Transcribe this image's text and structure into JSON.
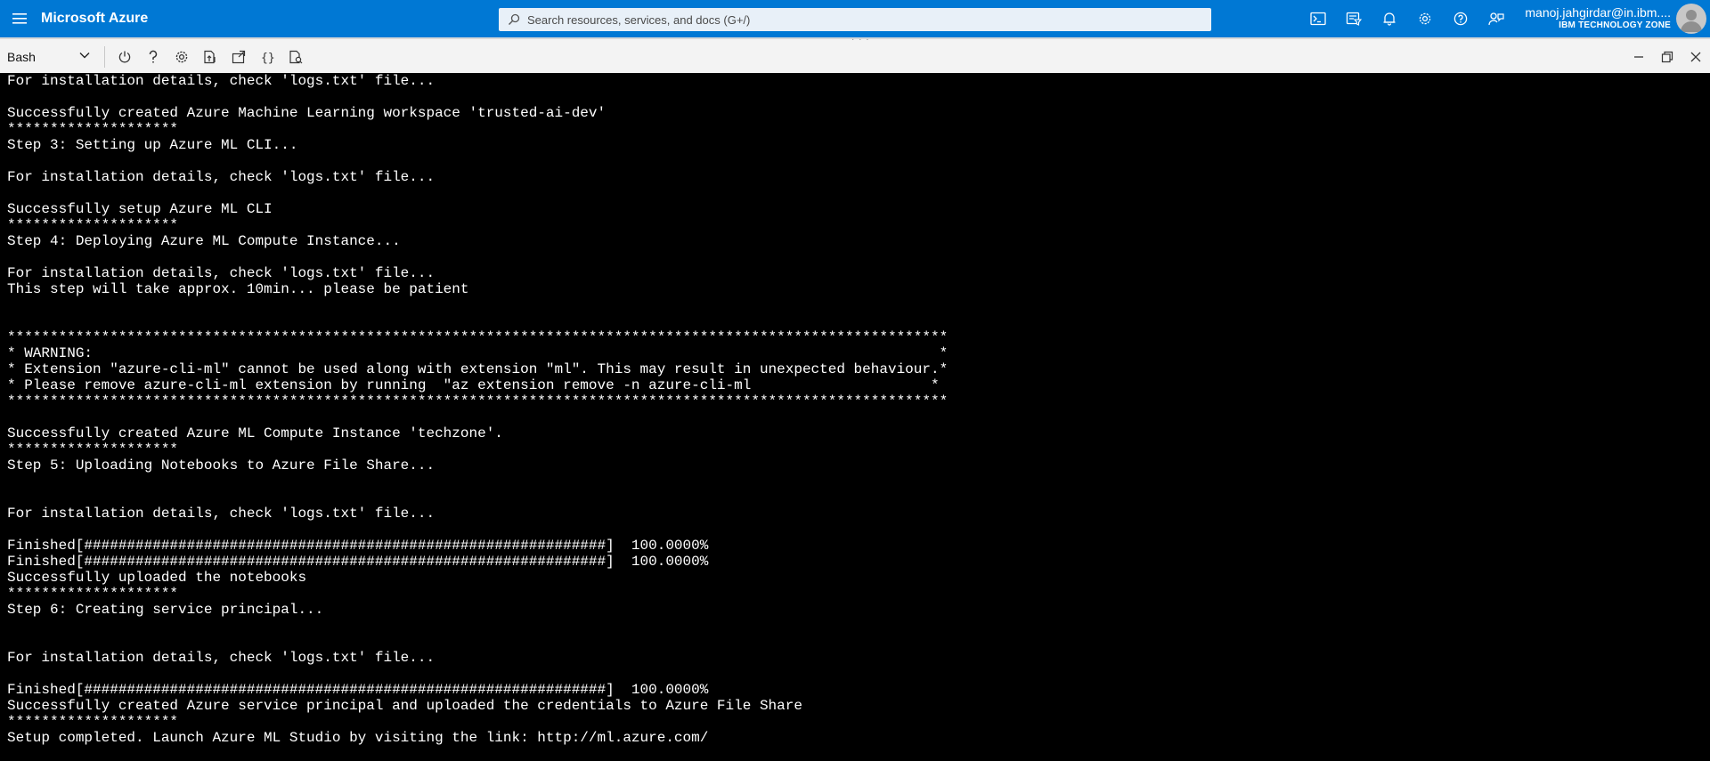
{
  "header": {
    "brand": "Microsoft Azure",
    "search_placeholder": "Search resources, services, and docs (G+/)",
    "account_name": "manoj.jahgirdar@in.ibm....",
    "account_org": "IBM TECHNOLOGY ZONE",
    "icons": [
      "cloud-shell-icon",
      "directory-filter-icon",
      "notifications-icon",
      "settings-icon",
      "help-icon",
      "feedback-icon"
    ]
  },
  "shell": {
    "selected": "Bash",
    "tools": [
      "power-icon",
      "help-icon",
      "settings-icon",
      "upload-download-icon",
      "open-new-session-icon",
      "editor-icon",
      "web-preview-icon"
    ]
  },
  "terminal": {
    "lines": [
      "For installation details, check 'logs.txt' file...",
      "",
      "Successfully created Azure Machine Learning workspace 'trusted-ai-dev'",
      "********************",
      "Step 3: Setting up Azure ML CLI...",
      "",
      "For installation details, check 'logs.txt' file...",
      "",
      "Successfully setup Azure ML CLI",
      "********************",
      "Step 4: Deploying Azure ML Compute Instance...",
      "",
      "For installation details, check 'logs.txt' file...",
      "This step will take approx. 10min... please be patient",
      "",
      "",
      "**************************************************************************************************************",
      "* WARNING:                                                                                                   *",
      "* Extension \"azure-cli-ml\" cannot be used along with extension \"ml\". This may result in unexpected behaviour.*",
      "* Please remove azure-cli-ml extension by running  \"az extension remove -n azure-cli-ml                     *",
      "**************************************************************************************************************",
      "",
      "Successfully created Azure ML Compute Instance 'techzone'.",
      "********************",
      "Step 5: Uploading Notebooks to Azure File Share...",
      "",
      "",
      "For installation details, check 'logs.txt' file...",
      "",
      "Finished[#############################################################]  100.0000%",
      "Finished[#############################################################]  100.0000%",
      "Successfully uploaded the notebooks",
      "********************",
      "Step 6: Creating service principal...",
      "",
      "",
      "For installation details, check 'logs.txt' file...",
      "",
      "Finished[#############################################################]  100.0000%",
      "Successfully created Azure service principal and uploaded the credentials to Azure File Share",
      "********************",
      "Setup completed. Launch Azure ML Studio by visiting the link: http://ml.azure.com/"
    ]
  }
}
